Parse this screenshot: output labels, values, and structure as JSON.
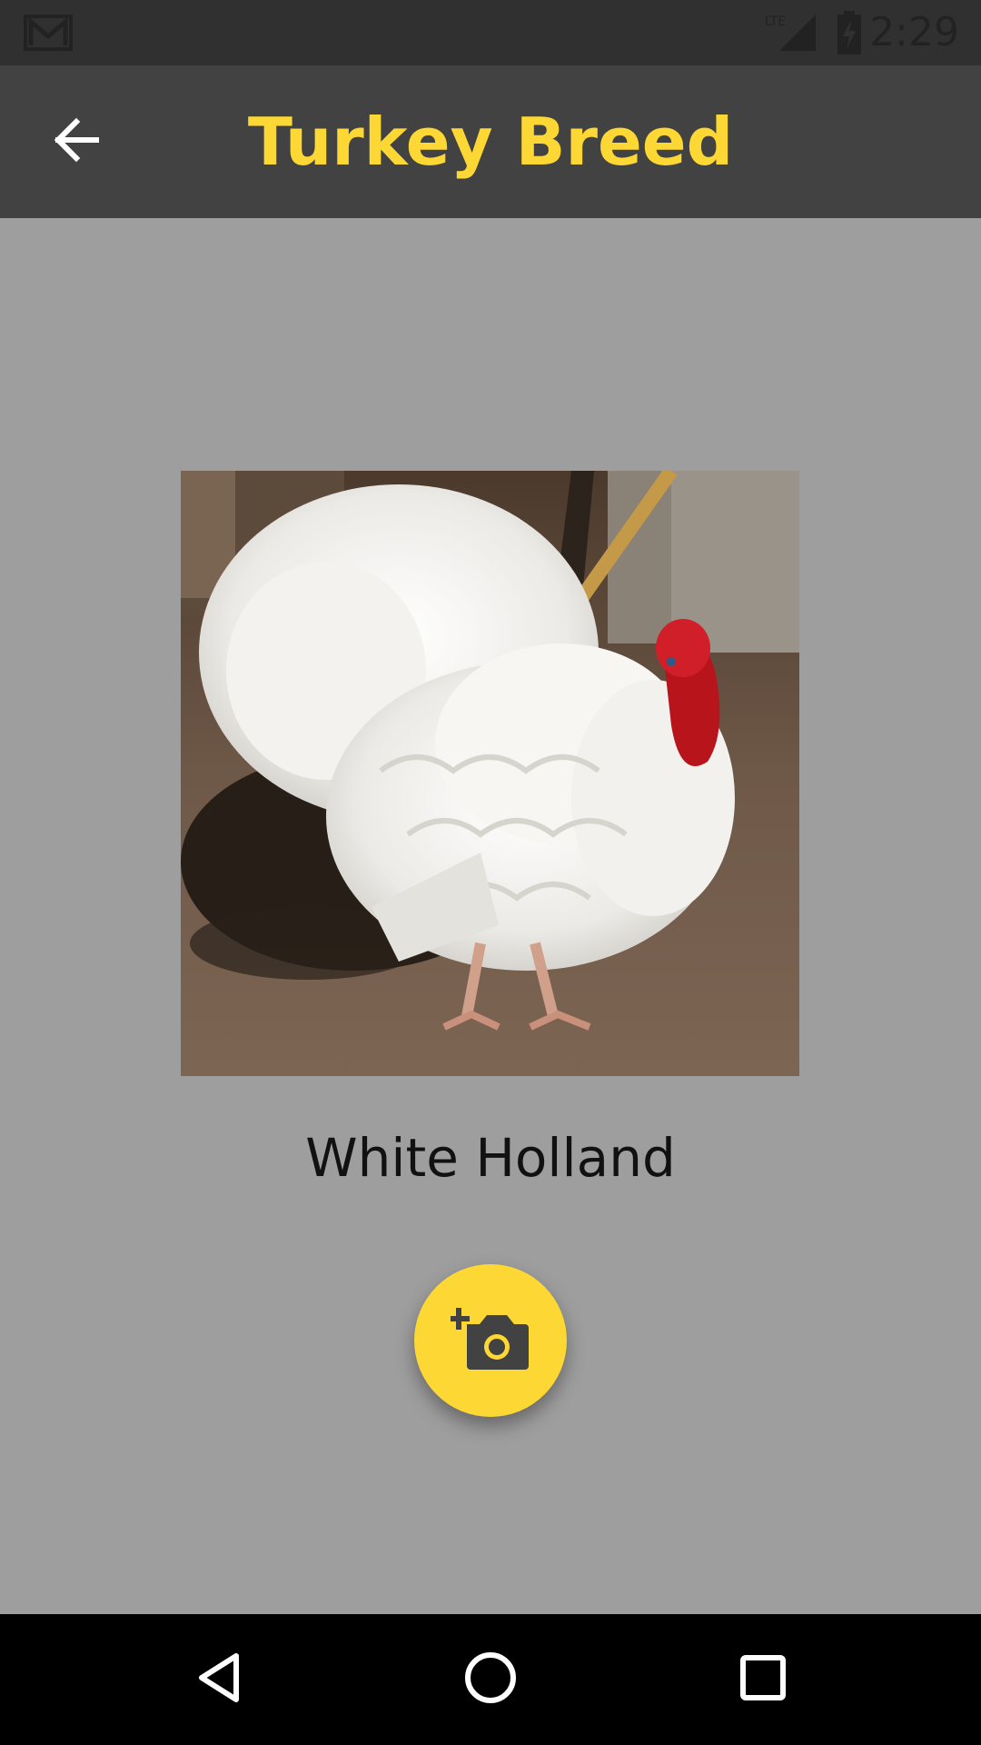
{
  "status_bar": {
    "time": "2:29",
    "network": "LTE",
    "icons": [
      "gmail-icon",
      "lte-signal-icon",
      "battery-charging-icon"
    ]
  },
  "app_bar": {
    "title": "Turkey Breed",
    "back_icon": "arrow-back-icon",
    "title_color": "#fdd835",
    "background": "#424242"
  },
  "breed": {
    "name": "White Holland",
    "image": "white-turkey-photo"
  },
  "fab": {
    "icon": "add-a-photo-icon",
    "color": "#fdd835"
  },
  "nav_bar": {
    "buttons": [
      "back-triangle-icon",
      "home-circle-icon",
      "recents-square-icon"
    ]
  },
  "colors": {
    "page_background": "#9e9e9e",
    "accent": "#fdd835"
  }
}
